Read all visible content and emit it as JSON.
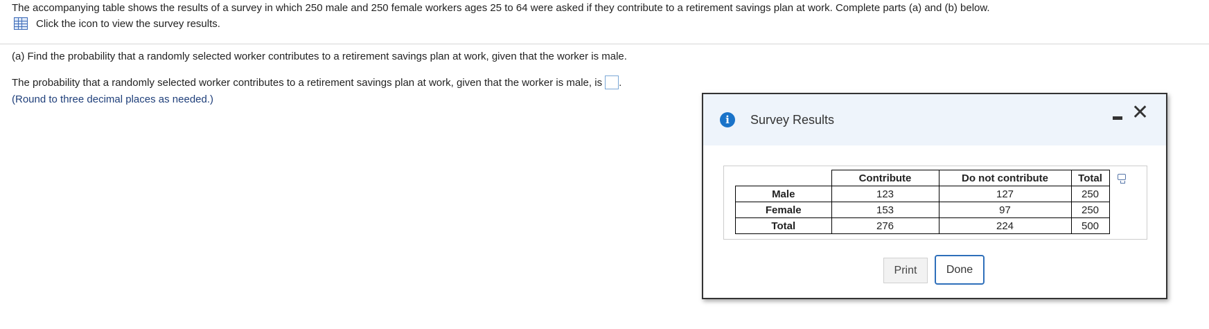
{
  "intro_text": "The accompanying table shows the results of a survey in which 250 male and 250 female workers ages 25 to 64 were asked if they contribute to a retirement savings plan at work. Complete parts (a) and (b) below.",
  "view_link_text": "Click the icon to view the survey results.",
  "part_a_question": "(a) Find the probability that a randomly selected worker contributes to a retirement savings plan at work, given that the worker is male.",
  "answer_sentence": "The probability that a randomly selected worker contributes to a retirement savings plan at work, given that the worker is male, is",
  "answer_value": "",
  "answer_suffix": ".",
  "rounding_hint": "(Round to three decimal places as needed.)",
  "dialog": {
    "title": "Survey Results",
    "minimize_glyph": "",
    "close_glyph": "✕",
    "table": {
      "headers": [
        "Contribute",
        "Do not contribute",
        "Total"
      ],
      "rows": [
        {
          "label": "Male",
          "values": [
            "123",
            "127",
            "250"
          ]
        },
        {
          "label": "Female",
          "values": [
            "153",
            "97",
            "250"
          ]
        },
        {
          "label": "Total",
          "values": [
            "276",
            "224",
            "500"
          ]
        }
      ]
    },
    "print_label": "Print",
    "done_label": "Done"
  },
  "colors": {
    "accent": "#2e6fba",
    "header_bg": "#eef4fb",
    "hint_text": "#1f3f7a",
    "info_icon": "#1a73c9"
  }
}
